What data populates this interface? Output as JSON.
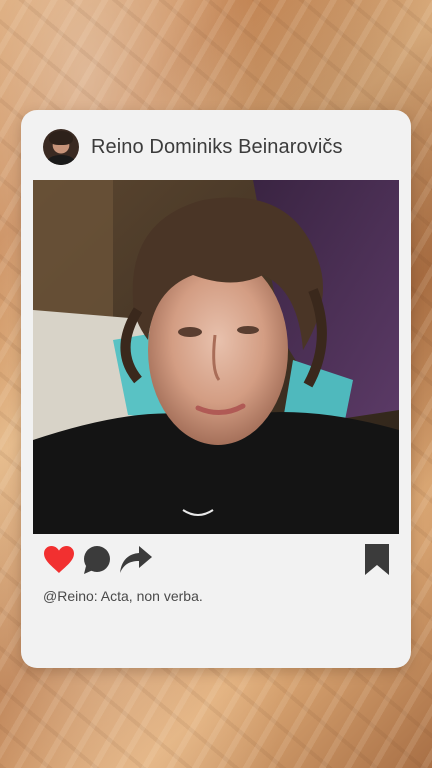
{
  "post": {
    "username": "Reino Dominiks Beinarovičs",
    "caption": "@Reino: Acta, non verba."
  },
  "icons": {
    "like": "heart-icon",
    "comment": "comment-bubble-icon",
    "share": "share-arrow-icon",
    "save": "bookmark-icon"
  },
  "colors": {
    "like": "#f23030",
    "icon_dark": "#3b3b3b",
    "card": "#f2f2f2"
  }
}
